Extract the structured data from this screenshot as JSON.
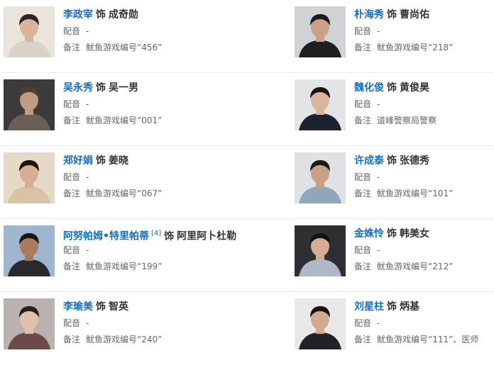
{
  "label_as": "饰",
  "label_voice": "配音",
  "label_note": "备注",
  "cast": [
    {
      "actor": "李政宰",
      "role": "成奇勋",
      "ref": "",
      "voice": "-",
      "note": "鱿鱼游戏编号“456”",
      "bg": "#e9e4dc",
      "shirt": "#d8d2c8",
      "hair": "#2b2420",
      "skin": "#d9b39a"
    },
    {
      "actor": "朴海秀",
      "role": "曹尚佑",
      "ref": "",
      "voice": "-",
      "note": "鱿鱼游戏编号“218”",
      "bg": "#cfd3d6",
      "shirt": "#1f1f22",
      "hair": "#1a1a1a",
      "skin": "#c9a187"
    },
    {
      "actor": "吴永秀",
      "role": "吴一男",
      "ref": "",
      "voice": "-",
      "note": "鱿鱼游戏编号“001”",
      "bg": "#3c3a3a",
      "shirt": "#6a5f55",
      "hair": "#4a4038",
      "skin": "#c49a80"
    },
    {
      "actor": "魏化俊",
      "role": "黄俊昊",
      "ref": "",
      "voice": "-",
      "note": "道峰警察局警察",
      "bg": "#e3e4e6",
      "shirt": "#1d2230",
      "hair": "#1a1614",
      "skin": "#dcb49b"
    },
    {
      "actor": "郑好娟",
      "role": "姜晓",
      "ref": "",
      "voice": "-",
      "note": "鱿鱼游戏编号“067”",
      "bg": "#e7d9c7",
      "shirt": "#d9c3a6",
      "hair": "#1b1411",
      "skin": "#d8ae92"
    },
    {
      "actor": "许成泰",
      "role": "张德秀",
      "ref": "",
      "voice": "-",
      "note": "鱿鱼游戏编号“101”",
      "bg": "#dfe2e4",
      "shirt": "#8fa6bd",
      "hair": "#1c1a18",
      "skin": "#c9a084"
    },
    {
      "actor": "阿努帕姆•特里帕蒂",
      "role": "阿里阿卜杜勒",
      "ref": "[4]",
      "voice": "-",
      "note": "鱿鱼游戏编号“199”",
      "bg": "#9fb6d0",
      "shirt": "#2a2a2e",
      "hair": "#191613",
      "skin": "#a87a5e"
    },
    {
      "actor": "金姝怜",
      "role": "韩美女",
      "ref": "",
      "voice": "-",
      "note": "鱿鱼游戏编号“212”",
      "bg": "#2d2f33",
      "shirt": "#aeb8c8",
      "hair": "#141212",
      "skin": "#d6ad93"
    },
    {
      "actor": "李瑜美",
      "role": "智英",
      "ref": "",
      "voice": "-",
      "note": "鱿鱼游戏编号“240”",
      "bg": "#b9b2b0",
      "shirt": "#6b4a47",
      "hair": "#2a1d18",
      "skin": "#e3c0aa"
    },
    {
      "actor": "刘星柱",
      "role": "炳基",
      "ref": "",
      "voice": "-",
      "note": "鱿鱼游戏编号“111”、医师",
      "bg": "#e8e8e8",
      "shirt": "#222226",
      "hair": "#161413",
      "skin": "#d3aa90"
    }
  ]
}
